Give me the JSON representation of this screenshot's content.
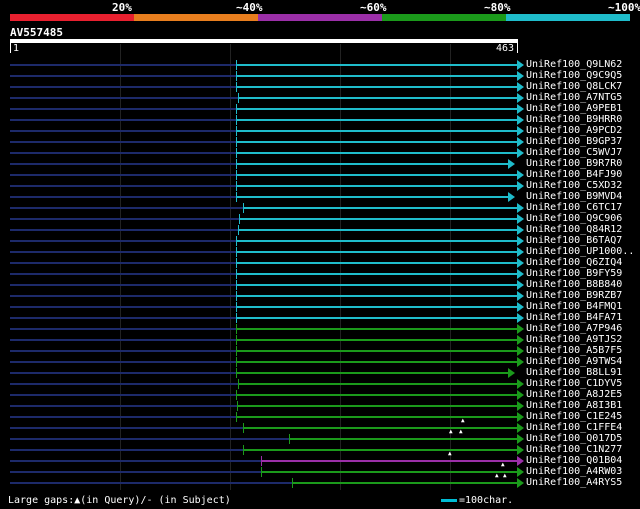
{
  "header": {
    "query_id": "AV557485",
    "ruler_start": "1",
    "ruler_end": "463",
    "legend": [
      {
        "label": "20%",
        "color": "#e8202f"
      },
      {
        "label": "~40%",
        "color": "#e87e1e"
      },
      {
        "label": "~60%",
        "color": "#9b2fa8"
      },
      {
        "label": "~80%",
        "color": "#1b9a1b"
      },
      {
        "label": "~100%",
        "color": "#1fbccb"
      }
    ]
  },
  "footer": {
    "gap_note": "Large gaps:▲(in Query)/- (in Subject)",
    "scale_label": "=100char."
  },
  "hits": [
    {
      "label": "UniRef100_Q9LN62",
      "color": "#1fbccb",
      "start": 207,
      "end": 463
    },
    {
      "label": "UniRef100_Q9C9Q5",
      "color": "#1fbccb",
      "start": 207,
      "end": 463
    },
    {
      "label": "UniRef100_Q8LCK7",
      "color": "#1fbccb",
      "start": 207,
      "end": 463
    },
    {
      "label": "UniRef100_A7NTG5",
      "color": "#1fbccb",
      "start": 209,
      "end": 463
    },
    {
      "label": "UniRef100_A9PEB1",
      "color": "#1fbccb",
      "start": 207,
      "end": 463
    },
    {
      "label": "UniRef100_B9HRR0",
      "color": "#1fbccb",
      "start": 207,
      "end": 463
    },
    {
      "label": "UniRef100_A9PCD2",
      "color": "#1fbccb",
      "start": 207,
      "end": 463
    },
    {
      "label": "UniRef100_B9GP37",
      "color": "#1fbccb",
      "start": 207,
      "end": 463
    },
    {
      "label": "UniRef100_C5WVJ7",
      "color": "#1fbccb",
      "start": 207,
      "end": 463
    },
    {
      "label": "UniRef100_B9R7R0",
      "color": "#1fbccb",
      "start": 207,
      "end": 455
    },
    {
      "label": "UniRef100_B4FJ90",
      "color": "#1fbccb",
      "start": 207,
      "end": 463
    },
    {
      "label": "UniRef100_C5XD32",
      "color": "#1fbccb",
      "start": 207,
      "end": 463
    },
    {
      "label": "UniRef100_B9MVD4",
      "color": "#1fbccb",
      "start": 207,
      "end": 455
    },
    {
      "label": "UniRef100_C6TC17",
      "color": "#1fbccb",
      "start": 213,
      "end": 463
    },
    {
      "label": "UniRef100_Q9C906",
      "color": "#1fbccb",
      "start": 210,
      "end": 463
    },
    {
      "label": "UniRef100_Q84R12",
      "color": "#1fbccb",
      "start": 209,
      "end": 463
    },
    {
      "label": "UniRef100_B6TAQ7",
      "color": "#1fbccb",
      "start": 207,
      "end": 463
    },
    {
      "label": "UniRef100_UP1000..",
      "color": "#1fbccb",
      "start": 207,
      "end": 463
    },
    {
      "label": "UniRef100_Q6ZIQ4",
      "color": "#1fbccb",
      "start": 207,
      "end": 463
    },
    {
      "label": "UniRef100_B9FY59",
      "color": "#1fbccb",
      "start": 207,
      "end": 463
    },
    {
      "label": "UniRef100_B8B840",
      "color": "#1fbccb",
      "start": 207,
      "end": 463
    },
    {
      "label": "UniRef100_B9RZB7",
      "color": "#1fbccb",
      "start": 207,
      "end": 463
    },
    {
      "label": "UniRef100_B4FMQ1",
      "color": "#1fbccb",
      "start": 207,
      "end": 463
    },
    {
      "label": "UniRef100_B4FA71",
      "color": "#1fbccb",
      "start": 207,
      "end": 463
    },
    {
      "label": "UniRef100_A7P946",
      "color": "#1b9a1b",
      "start": 207,
      "end": 463
    },
    {
      "label": "UniRef100_A9TJS2",
      "color": "#1b9a1b",
      "start": 207,
      "end": 463
    },
    {
      "label": "UniRef100_A5B7F5",
      "color": "#1b9a1b",
      "start": 207,
      "end": 463
    },
    {
      "label": "UniRef100_A9TWS4",
      "color": "#1b9a1b",
      "start": 207,
      "end": 463
    },
    {
      "label": "UniRef100_B8LL91",
      "color": "#1b9a1b",
      "start": 207,
      "end": 455
    },
    {
      "label": "UniRef100_C1DYV5",
      "color": "#1b9a1b",
      "start": 209,
      "end": 463
    },
    {
      "label": "UniRef100_A8J2E5",
      "color": "#1b9a1b",
      "start": 207,
      "end": 463
    },
    {
      "label": "UniRef100_A8I3B1",
      "color": "#1b9a1b",
      "start": 208,
      "end": 463
    },
    {
      "label": "UniRef100_C1E245",
      "color": "#1b9a1b",
      "start": 207,
      "end": 463
    },
    {
      "label": "UniRef100_C1FFE4",
      "color": "#1b9a1b",
      "start": 213,
      "end": 463
    },
    {
      "label": "UniRef100_Q017D5",
      "color": "#1b9a1b",
      "start": 255,
      "end": 463
    },
    {
      "label": "UniRef100_C1N277",
      "color": "#1b9a1b",
      "start": 213,
      "end": 463
    },
    {
      "label": "UniRef100_Q01B04",
      "color": "#9b2fa8",
      "start": 230,
      "end": 463
    },
    {
      "label": "UniRef100_A4RW03",
      "color": "#1b9a1b",
      "start": 230,
      "end": 463
    },
    {
      "label": "UniRef100_A4RYS5",
      "color": "#1b9a1b",
      "start": 258,
      "end": 463
    }
  ]
}
